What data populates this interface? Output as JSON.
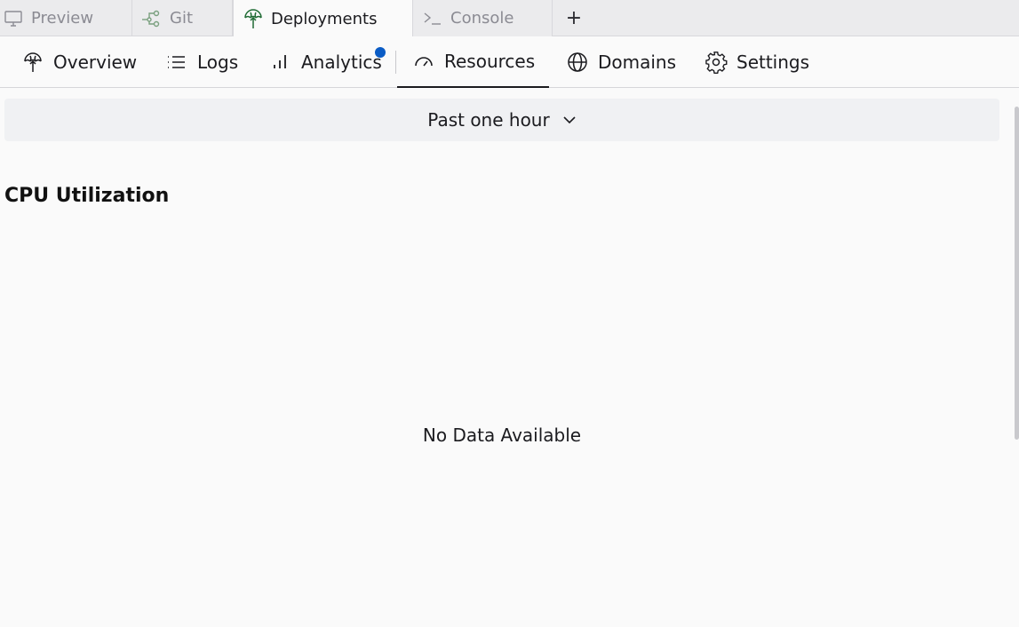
{
  "tabs": [
    {
      "label": "Preview",
      "icon": "monitor-icon"
    },
    {
      "label": "Git",
      "icon": "git-branch-icon"
    },
    {
      "label": "Deployments",
      "icon": "deployments-icon"
    },
    {
      "label": "Console",
      "icon": "terminal-icon"
    }
  ],
  "new_tab_label": "+",
  "subnav": [
    {
      "label": "Overview",
      "icon": "deployments-icon"
    },
    {
      "label": "Logs",
      "icon": "list-icon"
    },
    {
      "label": "Analytics",
      "icon": "bar-chart-icon"
    },
    {
      "label": "Resources",
      "icon": "gauge-icon"
    },
    {
      "label": "Domains",
      "icon": "globe-icon"
    },
    {
      "label": "Settings",
      "icon": "gear-icon"
    }
  ],
  "active_subnav": "Resources",
  "time_range": {
    "selected": "Past one hour"
  },
  "section": {
    "title": "CPU Utilization",
    "empty_text": "No Data Available"
  },
  "colors": {
    "accent_dot": "#0b5cc5",
    "deploy_icon": "#1f6b34"
  }
}
